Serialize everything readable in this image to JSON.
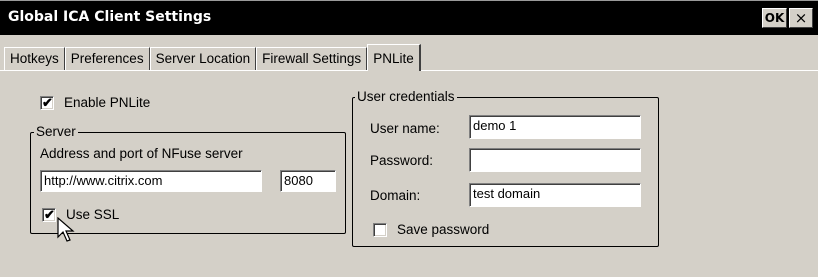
{
  "window": {
    "title": "Global ICA Client Settings",
    "ok_label": "OK",
    "close_label": "×"
  },
  "tabs": [
    {
      "label": "Hotkeys"
    },
    {
      "label": "Preferences"
    },
    {
      "label": "Server Location"
    },
    {
      "label": "Firewall Settings"
    },
    {
      "label": "PNLite",
      "active": true
    }
  ],
  "pnlite": {
    "enable_label": "Enable PNLite",
    "enable_checked": true,
    "server": {
      "title": "Server",
      "address_label": "Address and port of NFuse server",
      "address_value": "http://www.citrix.com",
      "port_value": "8080",
      "ssl_label": "Use SSL",
      "ssl_checked": true
    },
    "credentials": {
      "title": "User credentials",
      "username_label": "User name:",
      "username_value": "demo 1",
      "password_label": "Password:",
      "password_value": "",
      "domain_label": "Domain:",
      "domain_value": "test domain",
      "save_label": "Save password",
      "save_checked": false
    }
  }
}
